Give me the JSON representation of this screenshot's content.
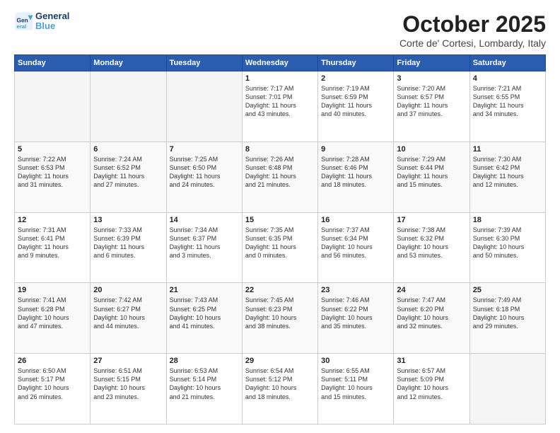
{
  "logo": {
    "line1": "General",
    "line2": "Blue"
  },
  "title": "October 2025",
  "subtitle": "Corte de' Cortesi, Lombardy, Italy",
  "weekdays": [
    "Sunday",
    "Monday",
    "Tuesday",
    "Wednesday",
    "Thursday",
    "Friday",
    "Saturday"
  ],
  "weeks": [
    [
      {
        "day": "",
        "info": ""
      },
      {
        "day": "",
        "info": ""
      },
      {
        "day": "",
        "info": ""
      },
      {
        "day": "1",
        "info": "Sunrise: 7:17 AM\nSunset: 7:01 PM\nDaylight: 11 hours\nand 43 minutes."
      },
      {
        "day": "2",
        "info": "Sunrise: 7:19 AM\nSunset: 6:59 PM\nDaylight: 11 hours\nand 40 minutes."
      },
      {
        "day": "3",
        "info": "Sunrise: 7:20 AM\nSunset: 6:57 PM\nDaylight: 11 hours\nand 37 minutes."
      },
      {
        "day": "4",
        "info": "Sunrise: 7:21 AM\nSunset: 6:55 PM\nDaylight: 11 hours\nand 34 minutes."
      }
    ],
    [
      {
        "day": "5",
        "info": "Sunrise: 7:22 AM\nSunset: 6:53 PM\nDaylight: 11 hours\nand 31 minutes."
      },
      {
        "day": "6",
        "info": "Sunrise: 7:24 AM\nSunset: 6:52 PM\nDaylight: 11 hours\nand 27 minutes."
      },
      {
        "day": "7",
        "info": "Sunrise: 7:25 AM\nSunset: 6:50 PM\nDaylight: 11 hours\nand 24 minutes."
      },
      {
        "day": "8",
        "info": "Sunrise: 7:26 AM\nSunset: 6:48 PM\nDaylight: 11 hours\nand 21 minutes."
      },
      {
        "day": "9",
        "info": "Sunrise: 7:28 AM\nSunset: 6:46 PM\nDaylight: 11 hours\nand 18 minutes."
      },
      {
        "day": "10",
        "info": "Sunrise: 7:29 AM\nSunset: 6:44 PM\nDaylight: 11 hours\nand 15 minutes."
      },
      {
        "day": "11",
        "info": "Sunrise: 7:30 AM\nSunset: 6:42 PM\nDaylight: 11 hours\nand 12 minutes."
      }
    ],
    [
      {
        "day": "12",
        "info": "Sunrise: 7:31 AM\nSunset: 6:41 PM\nDaylight: 11 hours\nand 9 minutes."
      },
      {
        "day": "13",
        "info": "Sunrise: 7:33 AM\nSunset: 6:39 PM\nDaylight: 11 hours\nand 6 minutes."
      },
      {
        "day": "14",
        "info": "Sunrise: 7:34 AM\nSunset: 6:37 PM\nDaylight: 11 hours\nand 3 minutes."
      },
      {
        "day": "15",
        "info": "Sunrise: 7:35 AM\nSunset: 6:35 PM\nDaylight: 11 hours\nand 0 minutes."
      },
      {
        "day": "16",
        "info": "Sunrise: 7:37 AM\nSunset: 6:34 PM\nDaylight: 10 hours\nand 56 minutes."
      },
      {
        "day": "17",
        "info": "Sunrise: 7:38 AM\nSunset: 6:32 PM\nDaylight: 10 hours\nand 53 minutes."
      },
      {
        "day": "18",
        "info": "Sunrise: 7:39 AM\nSunset: 6:30 PM\nDaylight: 10 hours\nand 50 minutes."
      }
    ],
    [
      {
        "day": "19",
        "info": "Sunrise: 7:41 AM\nSunset: 6:28 PM\nDaylight: 10 hours\nand 47 minutes."
      },
      {
        "day": "20",
        "info": "Sunrise: 7:42 AM\nSunset: 6:27 PM\nDaylight: 10 hours\nand 44 minutes."
      },
      {
        "day": "21",
        "info": "Sunrise: 7:43 AM\nSunset: 6:25 PM\nDaylight: 10 hours\nand 41 minutes."
      },
      {
        "day": "22",
        "info": "Sunrise: 7:45 AM\nSunset: 6:23 PM\nDaylight: 10 hours\nand 38 minutes."
      },
      {
        "day": "23",
        "info": "Sunrise: 7:46 AM\nSunset: 6:22 PM\nDaylight: 10 hours\nand 35 minutes."
      },
      {
        "day": "24",
        "info": "Sunrise: 7:47 AM\nSunset: 6:20 PM\nDaylight: 10 hours\nand 32 minutes."
      },
      {
        "day": "25",
        "info": "Sunrise: 7:49 AM\nSunset: 6:18 PM\nDaylight: 10 hours\nand 29 minutes."
      }
    ],
    [
      {
        "day": "26",
        "info": "Sunrise: 6:50 AM\nSunset: 5:17 PM\nDaylight: 10 hours\nand 26 minutes."
      },
      {
        "day": "27",
        "info": "Sunrise: 6:51 AM\nSunset: 5:15 PM\nDaylight: 10 hours\nand 23 minutes."
      },
      {
        "day": "28",
        "info": "Sunrise: 6:53 AM\nSunset: 5:14 PM\nDaylight: 10 hours\nand 21 minutes."
      },
      {
        "day": "29",
        "info": "Sunrise: 6:54 AM\nSunset: 5:12 PM\nDaylight: 10 hours\nand 18 minutes."
      },
      {
        "day": "30",
        "info": "Sunrise: 6:55 AM\nSunset: 5:11 PM\nDaylight: 10 hours\nand 15 minutes."
      },
      {
        "day": "31",
        "info": "Sunrise: 6:57 AM\nSunset: 5:09 PM\nDaylight: 10 hours\nand 12 minutes."
      },
      {
        "day": "",
        "info": ""
      }
    ]
  ]
}
